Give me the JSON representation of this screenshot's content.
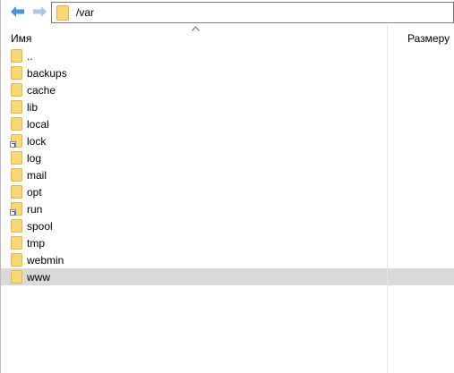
{
  "toolbar": {
    "back_icon": "arrow-left-icon",
    "forward_icon": "arrow-right-icon",
    "path": "/var"
  },
  "columns": {
    "name": "Имя",
    "size": "Размеру",
    "sort": "ascending"
  },
  "colors": {
    "folder": "#f8d775",
    "folder_edge": "#e1b642",
    "nav_arrow": "#4a90d9",
    "selection": "#d9d9d9"
  },
  "files": [
    {
      "name": "..",
      "type": "folder",
      "link": false,
      "selected": false
    },
    {
      "name": "backups",
      "type": "folder",
      "link": false,
      "selected": false
    },
    {
      "name": "cache",
      "type": "folder",
      "link": false,
      "selected": false
    },
    {
      "name": "lib",
      "type": "folder",
      "link": false,
      "selected": false
    },
    {
      "name": "local",
      "type": "folder",
      "link": false,
      "selected": false
    },
    {
      "name": "lock",
      "type": "folder",
      "link": true,
      "selected": false
    },
    {
      "name": "log",
      "type": "folder",
      "link": false,
      "selected": false
    },
    {
      "name": "mail",
      "type": "folder",
      "link": false,
      "selected": false
    },
    {
      "name": "opt",
      "type": "folder",
      "link": false,
      "selected": false
    },
    {
      "name": "run",
      "type": "folder",
      "link": true,
      "selected": false
    },
    {
      "name": "spool",
      "type": "folder",
      "link": false,
      "selected": false
    },
    {
      "name": "tmp",
      "type": "folder",
      "link": false,
      "selected": false
    },
    {
      "name": "webmin",
      "type": "folder",
      "link": false,
      "selected": false
    },
    {
      "name": "www",
      "type": "folder",
      "link": false,
      "selected": true
    }
  ]
}
